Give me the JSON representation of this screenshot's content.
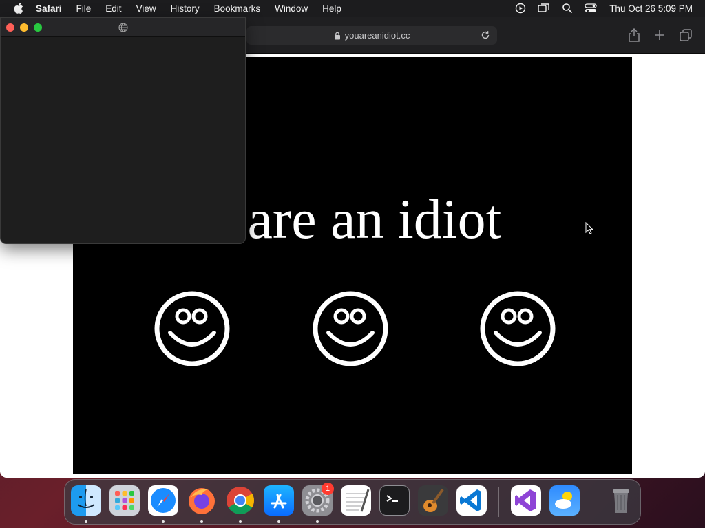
{
  "menubar": {
    "app_name": "Safari",
    "items": [
      "File",
      "Edit",
      "View",
      "History",
      "Bookmarks",
      "Window",
      "Help"
    ],
    "tray_icons": [
      "screen-record-icon",
      "screen-mirroring-icon",
      "spotlight-search-icon",
      "control-center-icon"
    ],
    "clock": "Thu Oct 26  5:09 PM"
  },
  "safari": {
    "url": "youareanidiot.cc",
    "toolbar_icons": [
      "share-icon",
      "new-tab-icon",
      "tab-overview-icon"
    ],
    "page": {
      "headline": "You are an idiot",
      "smiley_count": 3,
      "background": "#000000",
      "foreground": "#ffffff"
    }
  },
  "popup": {
    "title_icon": "globe-icon"
  },
  "dock": {
    "apps": [
      {
        "name": "Finder",
        "icon": "finder-icon",
        "running": true
      },
      {
        "name": "Launchpad",
        "icon": "launchpad-icon",
        "running": false
      },
      {
        "name": "Safari",
        "icon": "safari-icon",
        "running": true
      },
      {
        "name": "Firefox",
        "icon": "firefox-icon",
        "running": true
      },
      {
        "name": "Google Chrome",
        "icon": "chrome-icon",
        "running": true
      },
      {
        "name": "App Store",
        "icon": "app-store-icon",
        "running": true
      },
      {
        "name": "System Settings",
        "icon": "system-settings-icon",
        "running": true,
        "badge": "1"
      },
      {
        "name": "TextEdit",
        "icon": "textedit-icon",
        "running": false
      },
      {
        "name": "Terminal",
        "icon": "terminal-icon",
        "running": false
      },
      {
        "name": "GarageBand",
        "icon": "garageband-icon",
        "running": false
      },
      {
        "name": "Visual Studio Code",
        "icon": "vscode-icon",
        "running": false
      },
      {
        "name": "Visual Studio",
        "icon": "visual-studio-icon",
        "running": false
      },
      {
        "name": "Weather",
        "icon": "weather-icon",
        "running": false
      },
      {
        "name": "Trash",
        "icon": "trash-icon",
        "running": false
      }
    ]
  }
}
